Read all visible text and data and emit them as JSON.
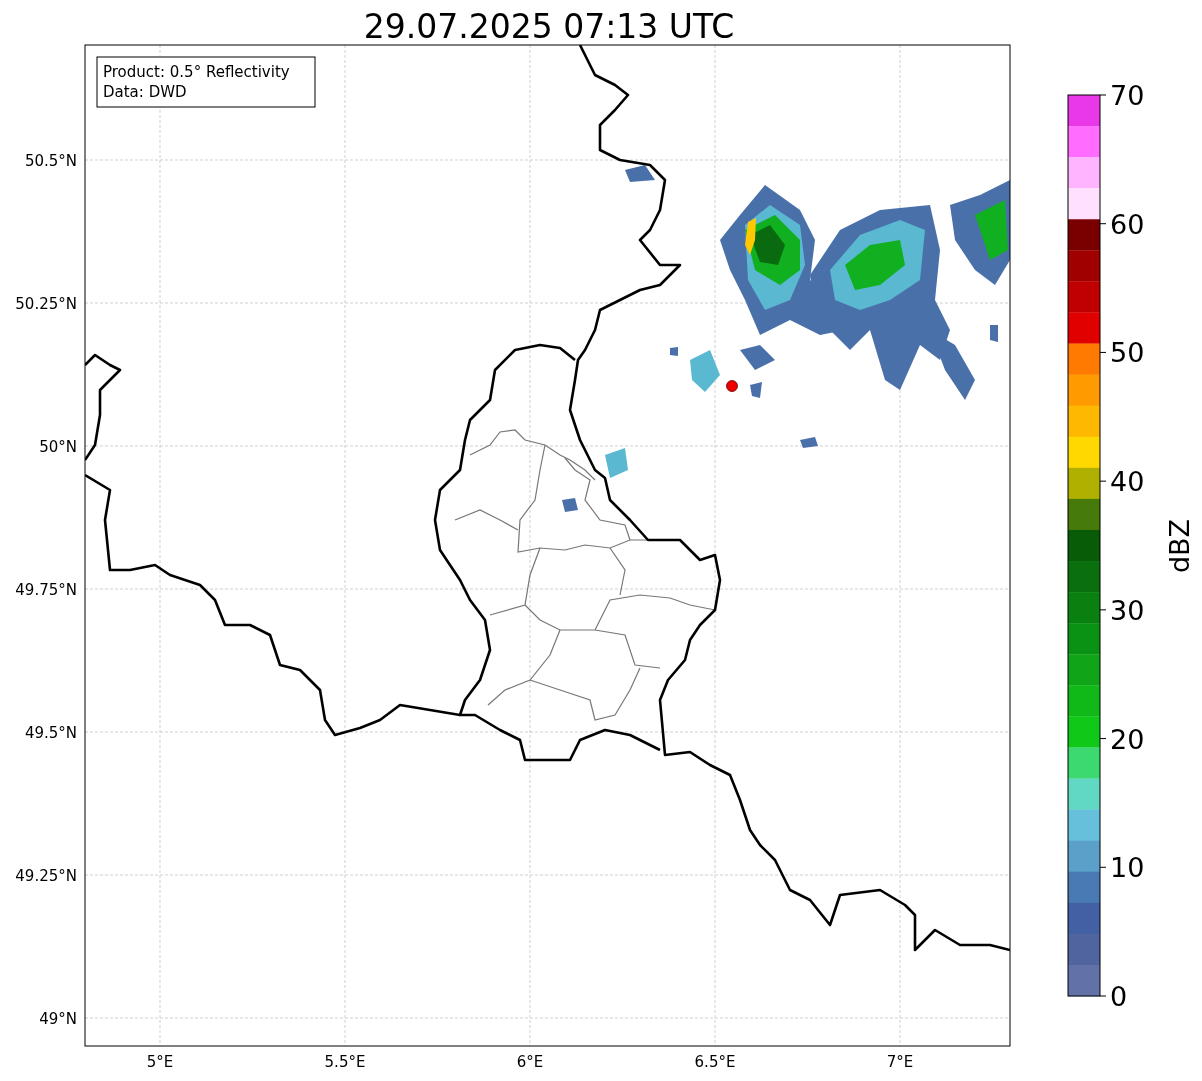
{
  "title": "29.07.2025 07:13 UTC",
  "info_box": {
    "lines": [
      "Product: 0.5° Reflectivity",
      "Data: DWD"
    ]
  },
  "map": {
    "yticks": [
      "50.5°N",
      "50.25°N",
      "50°N",
      "49.75°N",
      "49.5°N",
      "49.25°N",
      "49°N"
    ],
    "xticks": [
      "5°E",
      "5.5°E",
      "6°E",
      "6.5°E",
      "7°E"
    ]
  },
  "colorbar": {
    "label": "dBZ",
    "ticks": [
      "70",
      "60",
      "50",
      "40",
      "30",
      "20",
      "10",
      "0"
    ],
    "segments": [
      {
        "color": "#e838e8"
      },
      {
        "color": "#ff6cff"
      },
      {
        "color": "#ffb4ff"
      },
      {
        "color": "#ffe0ff"
      },
      {
        "color": "#7a0000"
      },
      {
        "color": "#a00000"
      },
      {
        "color": "#c00000"
      },
      {
        "color": "#e00000"
      },
      {
        "color": "#ff7a00"
      },
      {
        "color": "#ff9a00"
      },
      {
        "color": "#ffb800"
      },
      {
        "color": "#ffd800"
      },
      {
        "color": "#b0b000"
      },
      {
        "color": "#467a0a"
      },
      {
        "color": "#085c08"
      },
      {
        "color": "#0a700e"
      },
      {
        "color": "#0a8010"
      },
      {
        "color": "#0a9214"
      },
      {
        "color": "#10a418"
      },
      {
        "color": "#10b818"
      },
      {
        "color": "#10c818"
      },
      {
        "color": "#3cd870"
      },
      {
        "color": "#60d8c4"
      },
      {
        "color": "#66c0dc"
      },
      {
        "color": "#5aa0c8"
      },
      {
        "color": "#4a7ab4"
      },
      {
        "color": "#4460a4"
      },
      {
        "color": "#5064a0"
      },
      {
        "color": "#6272a8"
      }
    ]
  }
}
